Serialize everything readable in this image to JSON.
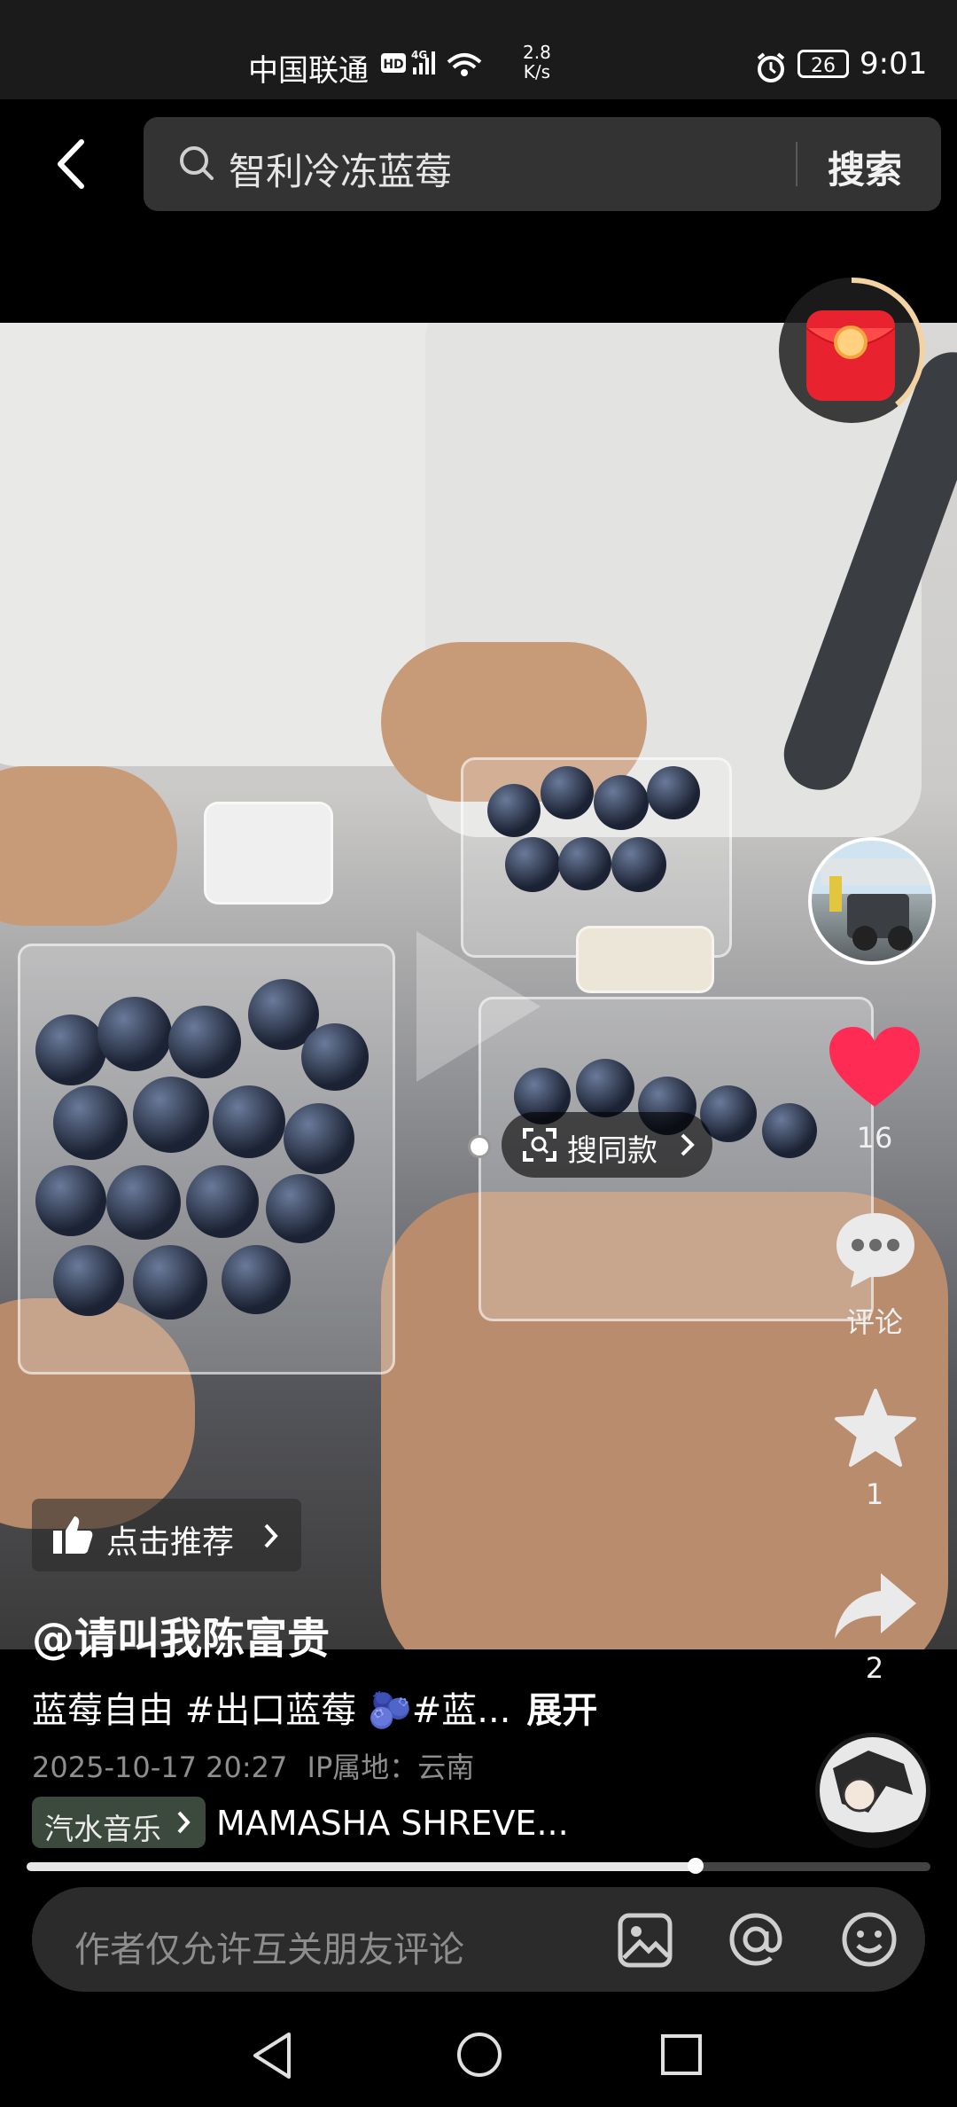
{
  "status_bar": {
    "carrier": "中国联通",
    "network": "HD 4G",
    "speed_value": "2.8",
    "speed_unit": "K/s",
    "battery": "26",
    "time": "9:01"
  },
  "search": {
    "query": "智利冷冻蓝莓",
    "button_label": "搜索"
  },
  "video": {
    "search_same_label": "搜同款",
    "recommend_label": "点击推荐",
    "author": "@请叫我陈富贵",
    "caption_text": "蓝莓自由 #出口蓝莓 🫐#蓝...",
    "expand_label": "展开",
    "date": "2025-10-17 20:27",
    "ip_location": "IP属地：云南",
    "music_tag": "汽水音乐",
    "music_title": "MAMASHA SHREVE...",
    "progress": 0.74
  },
  "side_actions": {
    "likes": "16",
    "comment_label": "评论",
    "favorites": "1",
    "shares": "2"
  },
  "comment_bar": {
    "placeholder": "作者仅允许互关朋友评论"
  },
  "colors": {
    "like_red": "#fe2c55",
    "red_packet": "#e8232f"
  }
}
